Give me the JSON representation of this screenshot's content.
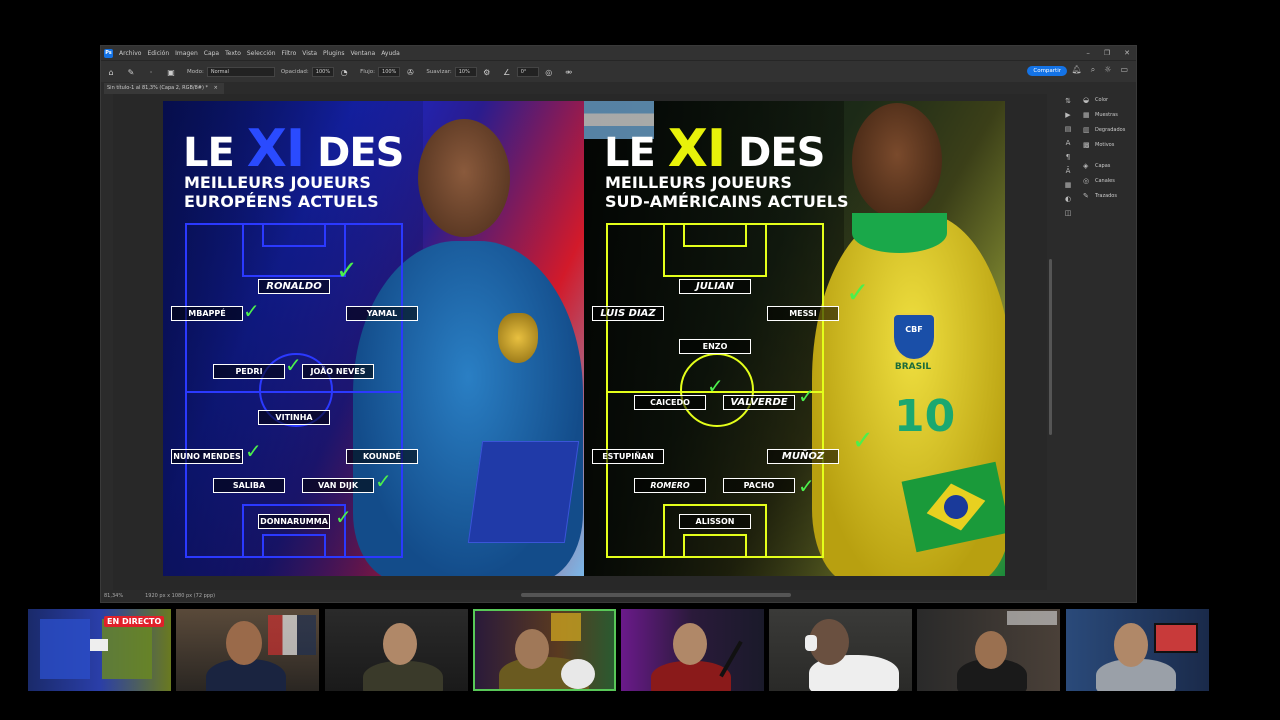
{
  "app": {
    "menu": [
      "Archivo",
      "Edición",
      "Imagen",
      "Capa",
      "Texto",
      "Selección",
      "Filtro",
      "Vista",
      "Plugins",
      "Ventana",
      "Ayuda"
    ],
    "options": {
      "mode_label": "Modo:",
      "mode_value": "Normal",
      "opacity_label": "Opacidad:",
      "opacity_value": "100%",
      "flow_label": "Flujo:",
      "flow_value": "100%",
      "smooth_label": "Suavizar:",
      "smooth_value": "10%",
      "angle_value": "0°",
      "share_label": "Compartir"
    },
    "document_tab": "Sin título-1 al 81,3% (Capa 2, RGB/8#) *",
    "status": {
      "zoom": "81,34%",
      "doc_info": "1920 px x 1080 px (72 ppp)"
    },
    "panels": [
      "Color",
      "Muestras",
      "Degradados",
      "Motivos",
      "Capas",
      "Canales",
      "Trazados"
    ]
  },
  "artwork": {
    "left": {
      "title_le": "LE",
      "title_xi": "XI",
      "title_des": "DES",
      "subtitle_1": "MEILLEURS JOUEURS",
      "subtitle_2": "EUROPÉENS ACTUELS",
      "accent_color": "#2b39ff",
      "players": {
        "ronaldo": "RONALDO",
        "mbappe": "MBAPPÉ",
        "yamal": "YAMAL",
        "pedri": "PEDRI",
        "joao_neves": "JOÃO NEVES",
        "vitinha": "VITINHA",
        "nuno_mendes": "NUNO MENDES",
        "kounde": "KOUNDÉ",
        "saliba": "SALIBA",
        "van_dijk": "VAN DIJK",
        "donnarumma": "DONNARUMMA"
      }
    },
    "right": {
      "title_le": "LE",
      "title_xi": "XI",
      "title_des": "DES",
      "subtitle_1": "MEILLEURS JOUEURS",
      "subtitle_2": "SUD-AMÉRICAINS ACTUELS",
      "accent_color": "#e4ff1a",
      "badge_text": "CBF",
      "badge_country": "BRASIL",
      "shirt_number": "10",
      "players": {
        "julian": "JULIAN",
        "luis_diaz": "LUIS DIAZ",
        "messi": "MESSI",
        "enzo": "ENZO",
        "caicedo": "CAICEDO",
        "valverde": "VALVERDE",
        "estupinan": "ESTUPIÑAN",
        "munoz": "MUÑOZ",
        "romero": "ROMERO",
        "pacho": "PACHO",
        "alisson": "ALISSON"
      }
    }
  },
  "stream": {
    "live_label": "EN DIRECTO"
  }
}
